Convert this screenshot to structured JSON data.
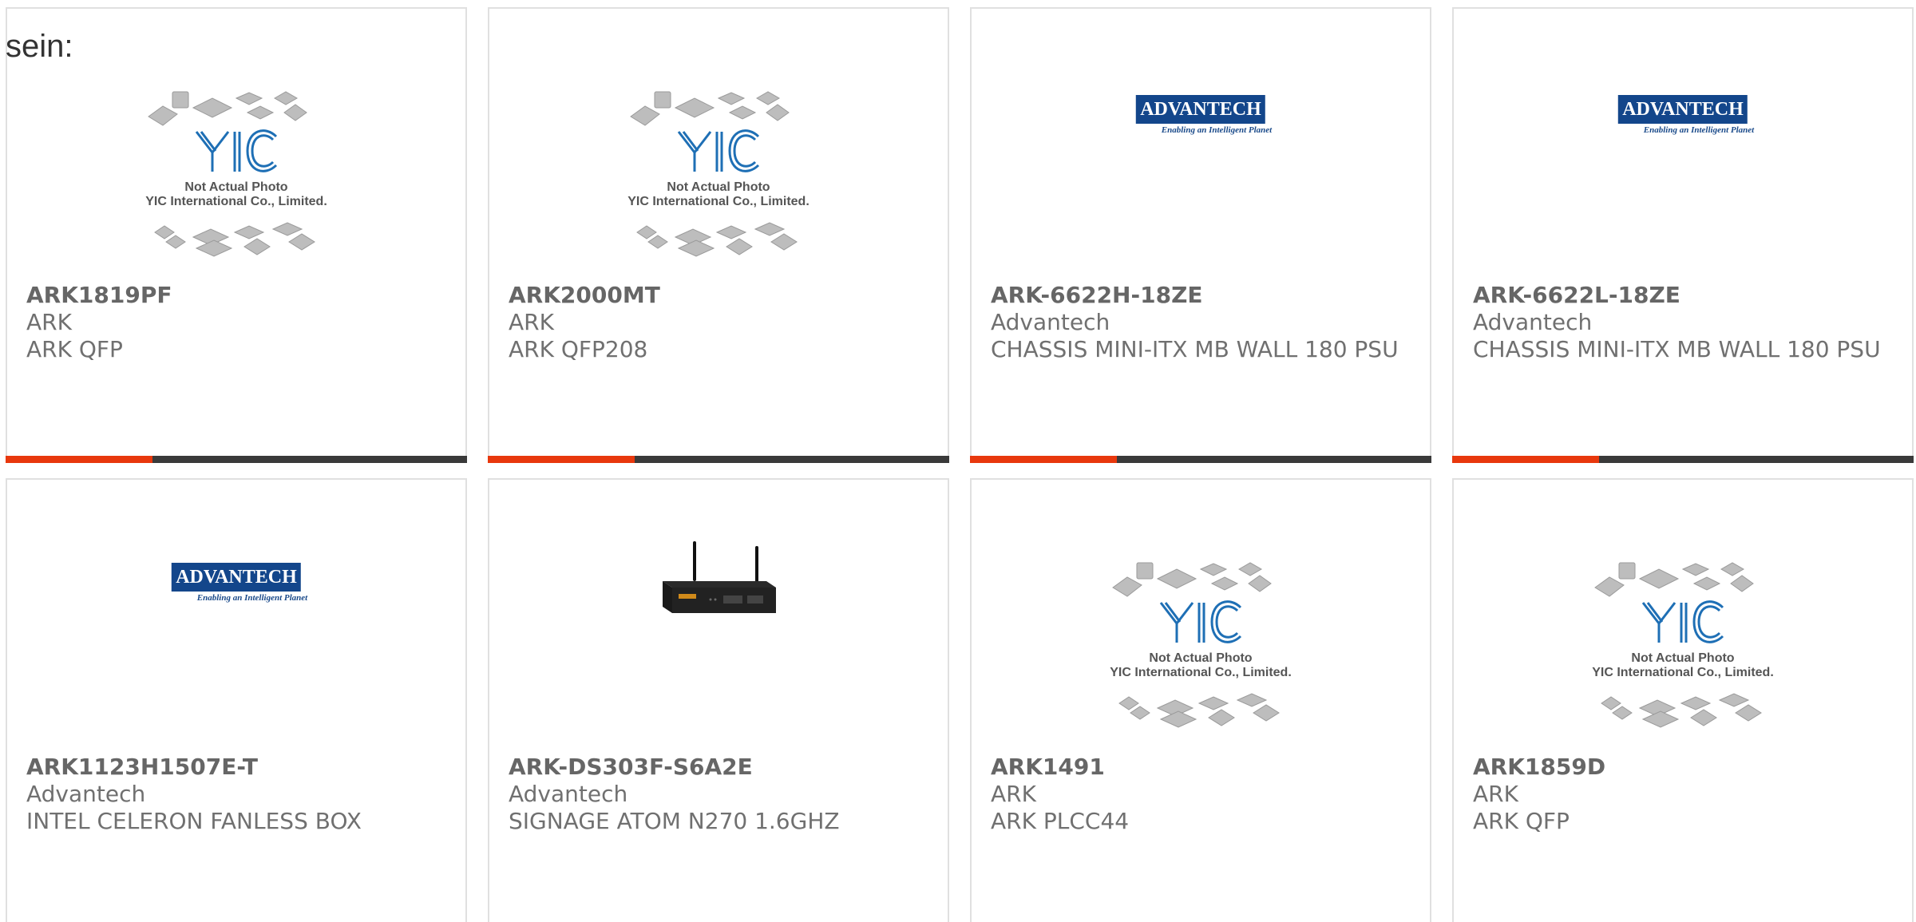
{
  "lead_text": "sein:",
  "colors": {
    "accent": "#e8380d",
    "bar": "#3a3a3a",
    "border": "#e0e0e0",
    "advantech_blue": "#13468b"
  },
  "placeholder": {
    "logo_text": "YIC",
    "line1": "Not Actual Photo",
    "line2": "YIC International Co., Limited."
  },
  "advantech_logo": {
    "name": "ADVANTECH",
    "tagline": "Enabling an Intelligent Planet"
  },
  "products": [
    {
      "part": "ARK1819PF",
      "manufacturer": "ARK",
      "description": "ARK QFP",
      "image": "yic-placeholder"
    },
    {
      "part": "ARK2000MT",
      "manufacturer": "ARK",
      "description": "ARK QFP208",
      "image": "yic-placeholder"
    },
    {
      "part": "ARK-6622H-18ZE",
      "manufacturer": "Advantech",
      "description": "CHASSIS MINI-ITX MB WALL 180 PSU",
      "image": "advantech-logo"
    },
    {
      "part": "ARK-6622L-18ZE",
      "manufacturer": "Advantech",
      "description": "CHASSIS MINI-ITX MB WALL 180 PSU",
      "image": "advantech-logo"
    },
    {
      "part": "ARK1123H1507E-T",
      "manufacturer": "Advantech",
      "description": "INTEL CELERON FANLESS BOX",
      "image": "advantech-logo"
    },
    {
      "part": "ARK-DS303F-S6A2E",
      "manufacturer": "Advantech",
      "description": "SIGNAGE ATOM N270 1.6GHZ",
      "image": "router-photo"
    },
    {
      "part": "ARK1491",
      "manufacturer": "ARK",
      "description": "ARK PLCC44",
      "image": "yic-placeholder"
    },
    {
      "part": "ARK1859D",
      "manufacturer": "ARK",
      "description": "ARK QFP",
      "image": "yic-placeholder"
    }
  ]
}
